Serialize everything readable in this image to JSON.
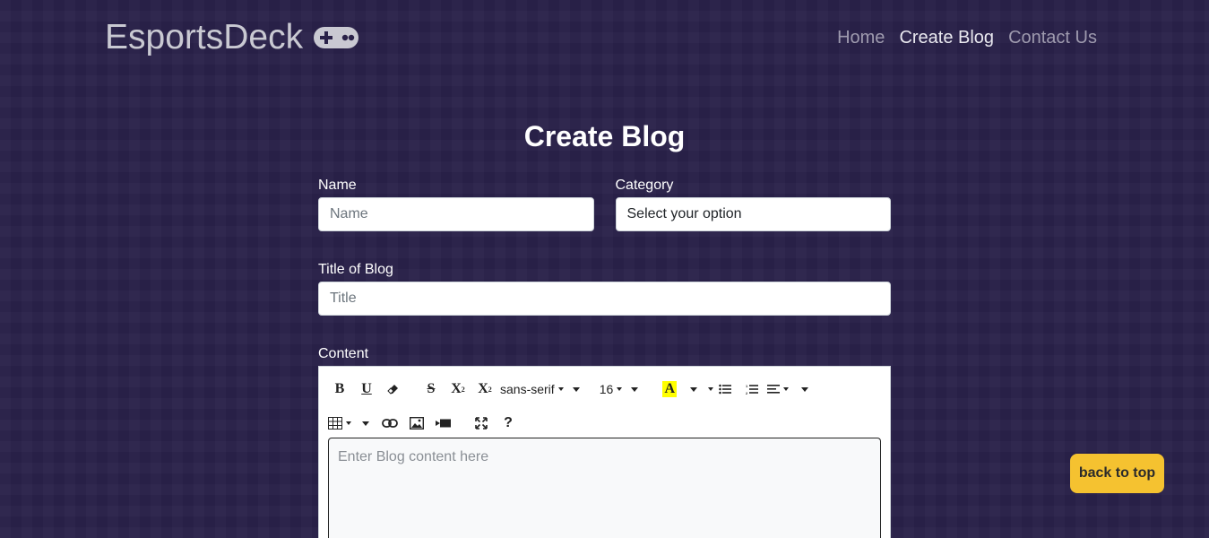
{
  "navbar": {
    "brand": "EsportsDeck",
    "brand_icon": "gamepad-icon",
    "links": [
      {
        "label": "Home",
        "active": false
      },
      {
        "label": "Create Blog",
        "active": true
      },
      {
        "label": "Contact Us",
        "active": false
      }
    ]
  },
  "page": {
    "title": "Create Blog"
  },
  "form": {
    "name_label": "Name",
    "name_placeholder": "Name",
    "category_label": "Category",
    "category_value": "Select your option",
    "title_label": "Title of Blog",
    "title_placeholder": "Title",
    "content_label": "Content",
    "content_placeholder": "Enter Blog content here"
  },
  "editor": {
    "font_family": "sans-serif",
    "font_size": "16",
    "bold": "B",
    "underline": "U",
    "strikethrough": "S",
    "superscript": "X",
    "subscript": "X",
    "color_letter": "A",
    "help": "?",
    "highlight_color": "#ffff00"
  },
  "back_to_top": "back to top",
  "colors": {
    "background": "#2a2249",
    "accent": "#f5c230"
  }
}
